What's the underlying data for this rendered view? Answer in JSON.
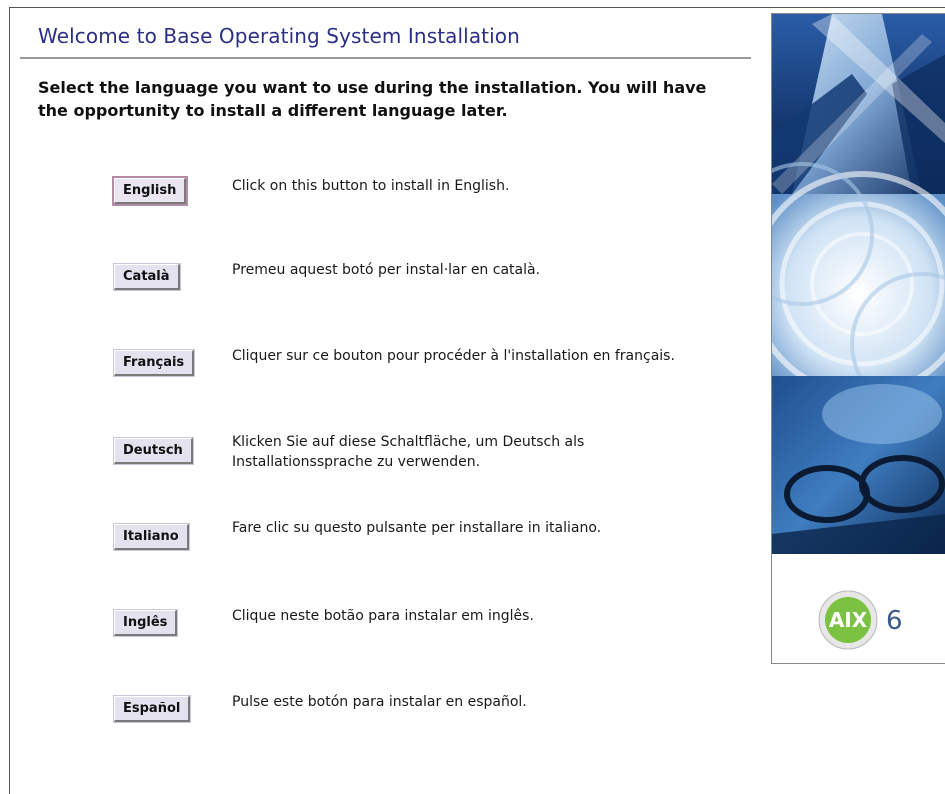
{
  "window": {
    "title": "Welcome to Base Operating System Installation",
    "intro": "Select the language you want to use during the installation. You will have the opportunity to install a different language later."
  },
  "languages": [
    {
      "label": "English",
      "description": "Click on this button to install in English."
    },
    {
      "label": "Català",
      "description": "Premeu aquest botó per instal·lar en català."
    },
    {
      "label": "Français",
      "description": "Cliquer sur ce bouton pour procéder à l'installation en français."
    },
    {
      "label": "Deutsch",
      "description": "Klicken Sie auf diese Schaltfläche, um Deutsch als Installationssprache zu verwenden."
    },
    {
      "label": "Italiano",
      "description": "Fare clic su questo pulsante per installare in italiano."
    },
    {
      "label": "Inglês",
      "description": "Clique neste botão para instalar em inglês."
    },
    {
      "label": "Español",
      "description": "Pulse este botón para instalar en español."
    }
  ],
  "branding": {
    "logo_text": "AIX",
    "version": "6"
  },
  "colors": {
    "title": "#2b2f85",
    "logo_green": "#7cc242"
  }
}
